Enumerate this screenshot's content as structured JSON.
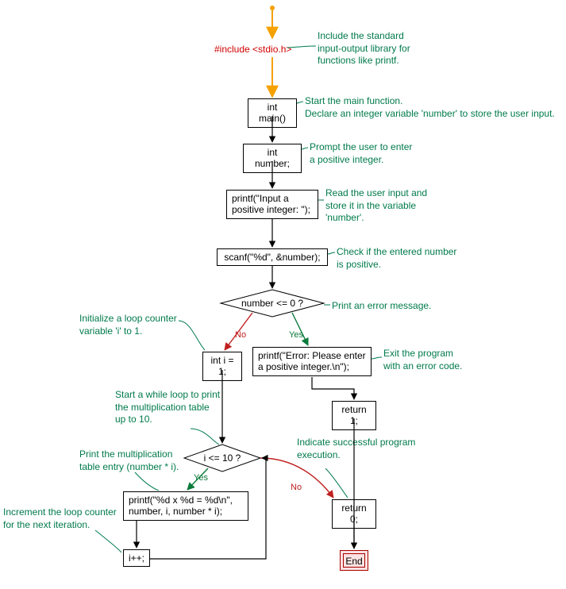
{
  "start": {
    "code": "#include <stdio.h>"
  },
  "nodes": {
    "main": {
      "code": "int main()"
    },
    "decl": {
      "code": "int number;"
    },
    "prompt": {
      "code": "printf(\"Input a\npositive integer: \");"
    },
    "scan": {
      "code": "scanf(\"%d\", &number);"
    },
    "cond1": {
      "code": "number <= 0 ?"
    },
    "error": {
      "code": "printf(\"Error: Please enter\na positive integer.\\n\");"
    },
    "init_i": {
      "code": "int i = 1;"
    },
    "ret1": {
      "code": "return 1;"
    },
    "cond2": {
      "code": "i <= 10 ?"
    },
    "body": {
      "code": "printf(\"%d x %d = %d\\n\",\nnumber, i, number * i);"
    },
    "inc": {
      "code": "i++;"
    },
    "ret0": {
      "code": "return 0;"
    },
    "end": {
      "code": "End"
    }
  },
  "edge_labels": {
    "no": "No",
    "yes": "Yes"
  },
  "annotations": {
    "a1": "Include the standard\ninput-output library for\nfunctions like printf.",
    "a2": "Start the main function.\nDeclare an integer variable 'number' to store the user input.",
    "a3": "Prompt the user to enter\na positive integer.",
    "a4": "Read the user input and\nstore it in the variable\n'number'.",
    "a5": "Check if the entered number\nis positive.",
    "a6": "Print an error message.",
    "a7": "Exit the program\nwith an error code.",
    "a8": "Initialize a loop counter\nvariable 'i' to 1.",
    "a9": "Start a while loop to print\nthe multiplication table\nup to 10.",
    "a10": "Print the multiplication\ntable entry (number * i).",
    "a11": "Increment the loop counter\nfor the next iteration.",
    "a12": "Indicate successful program\nexecution."
  },
  "colors": {
    "accent_red": "#d10000",
    "annotation": "#007a4c",
    "edge_black": "#000000",
    "edge_orange": "#f5a100",
    "edge_yes": "#0a7a3a",
    "edge_no": "#c02020"
  }
}
